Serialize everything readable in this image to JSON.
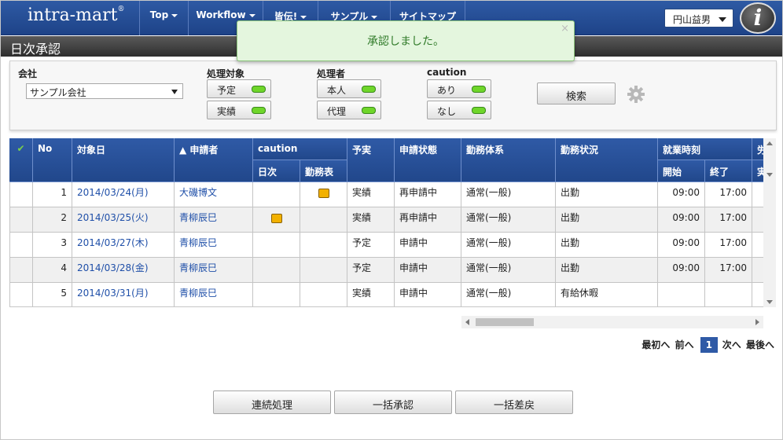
{
  "header": {
    "logo": "intra-mart",
    "nav": [
      {
        "label": "Top"
      },
      {
        "label": "Workflow"
      },
      {
        "label": "皆伝!"
      },
      {
        "label": "サンプル"
      },
      {
        "label": "サイトマップ"
      }
    ],
    "user": "円山益男",
    "avatar_letter": "i"
  },
  "page_title": "日次承認",
  "toast": {
    "message": "承認しました。",
    "close": "×"
  },
  "search": {
    "company_label": "会社",
    "company_value": "サンプル会社",
    "process_target_label": "処理対象",
    "process_target_options": [
      "予定",
      "実績"
    ],
    "processor_label": "処理者",
    "processor_options": [
      "本人",
      "代理"
    ],
    "caution_label": "caution",
    "caution_options": [
      "あり",
      "なし"
    ],
    "search_button": "検索",
    "led_color": "#6fd62a"
  },
  "table": {
    "headers": {
      "check": "✔",
      "no": "No",
      "date": "対象日",
      "applicant": "▲ 申請者",
      "caution": "caution",
      "caution_daily": "日次",
      "caution_schedule": "勤務表",
      "plan_actual": "予実",
      "status": "申請状態",
      "work_type": "勤務体系",
      "work_status": "勤務状況",
      "work_hours": "就業時刻",
      "start": "開始",
      "end": "終了",
      "next_col_top": "労",
      "next_col_bottom": "実"
    },
    "rows": [
      {
        "no": "1",
        "date": "2014/03/24(月)",
        "applicant": "大磯博文",
        "caution_daily": false,
        "caution_schedule": true,
        "plan_actual": "実績",
        "status": "再申請中",
        "work_type": "通常(一般)",
        "work_status": "出勤",
        "start": "09:00",
        "end": "17:00"
      },
      {
        "no": "2",
        "date": "2014/03/25(火)",
        "applicant": "青柳辰巳",
        "caution_daily": true,
        "caution_schedule": false,
        "plan_actual": "実績",
        "status": "再申請中",
        "work_type": "通常(一般)",
        "work_status": "出勤",
        "start": "09:00",
        "end": "17:00"
      },
      {
        "no": "3",
        "date": "2014/03/27(木)",
        "applicant": "青柳辰巳",
        "caution_daily": false,
        "caution_schedule": false,
        "plan_actual": "予定",
        "status": "申請中",
        "work_type": "通常(一般)",
        "work_status": "出勤",
        "start": "09:00",
        "end": "17:00"
      },
      {
        "no": "4",
        "date": "2014/03/28(金)",
        "applicant": "青柳辰巳",
        "caution_daily": false,
        "caution_schedule": false,
        "plan_actual": "予定",
        "status": "申請中",
        "work_type": "通常(一般)",
        "work_status": "出勤",
        "start": "09:00",
        "end": "17:00"
      },
      {
        "no": "5",
        "date": "2014/03/31(月)",
        "applicant": "青柳辰巳",
        "caution_daily": false,
        "caution_schedule": false,
        "plan_actual": "実績",
        "status": "申請中",
        "work_type": "通常(一般)",
        "work_status": "有給休暇",
        "start": "",
        "end": ""
      }
    ]
  },
  "pager": {
    "first": "最初へ",
    "prev": "前へ",
    "current": "1",
    "next": "次へ",
    "last": "最後へ"
  },
  "actions": {
    "sequential": "連続処理",
    "bulk_approve": "一括承認",
    "bulk_return": "一括差戻"
  },
  "colors": {
    "header_blue": "#2f5aa6",
    "toast_bg": "#e4f6de",
    "toast_text": "#2f7a28",
    "link": "#1f4fa8"
  }
}
